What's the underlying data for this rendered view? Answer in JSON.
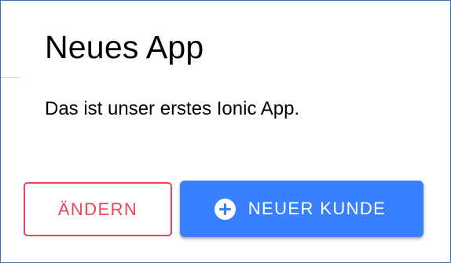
{
  "page": {
    "title": "Neues App",
    "text": "Das ist unser erstes Ionic App."
  },
  "buttons": {
    "edit_label": "ÄNDERN",
    "add_label": "NEUER KUNDE",
    "add_icon": "add-circle-icon"
  },
  "colors": {
    "danger": "#eb445a",
    "primary": "#3880ff",
    "frame_border": "#3b6fb6"
  }
}
